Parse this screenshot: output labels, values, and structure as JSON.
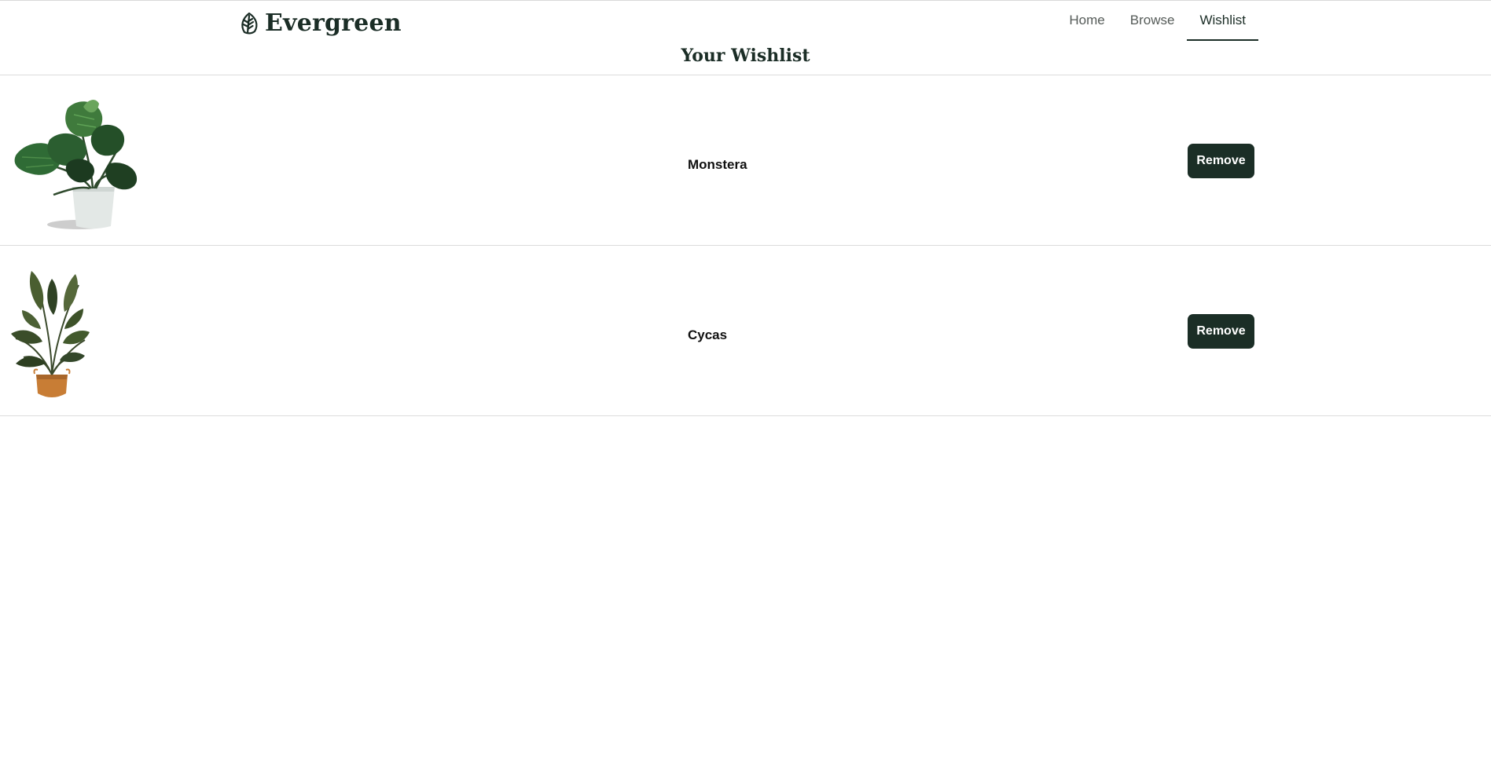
{
  "brand": {
    "name": "Evergreen",
    "icon": "leaf-icon"
  },
  "nav": {
    "items": [
      {
        "label": "Home",
        "active": false
      },
      {
        "label": "Browse",
        "active": false
      },
      {
        "label": "Wishlist",
        "active": true
      }
    ]
  },
  "page": {
    "title": "Your Wishlist"
  },
  "wishlist": {
    "items": [
      {
        "name": "Monstera",
        "image": "monstera-plant-image",
        "action_label": "Remove"
      },
      {
        "name": "Cycas",
        "image": "cycas-plant-image",
        "action_label": "Remove"
      }
    ]
  },
  "colors": {
    "primary": "#1b2e26",
    "divider": "#dcdcdc",
    "text": "#1b2d26"
  }
}
